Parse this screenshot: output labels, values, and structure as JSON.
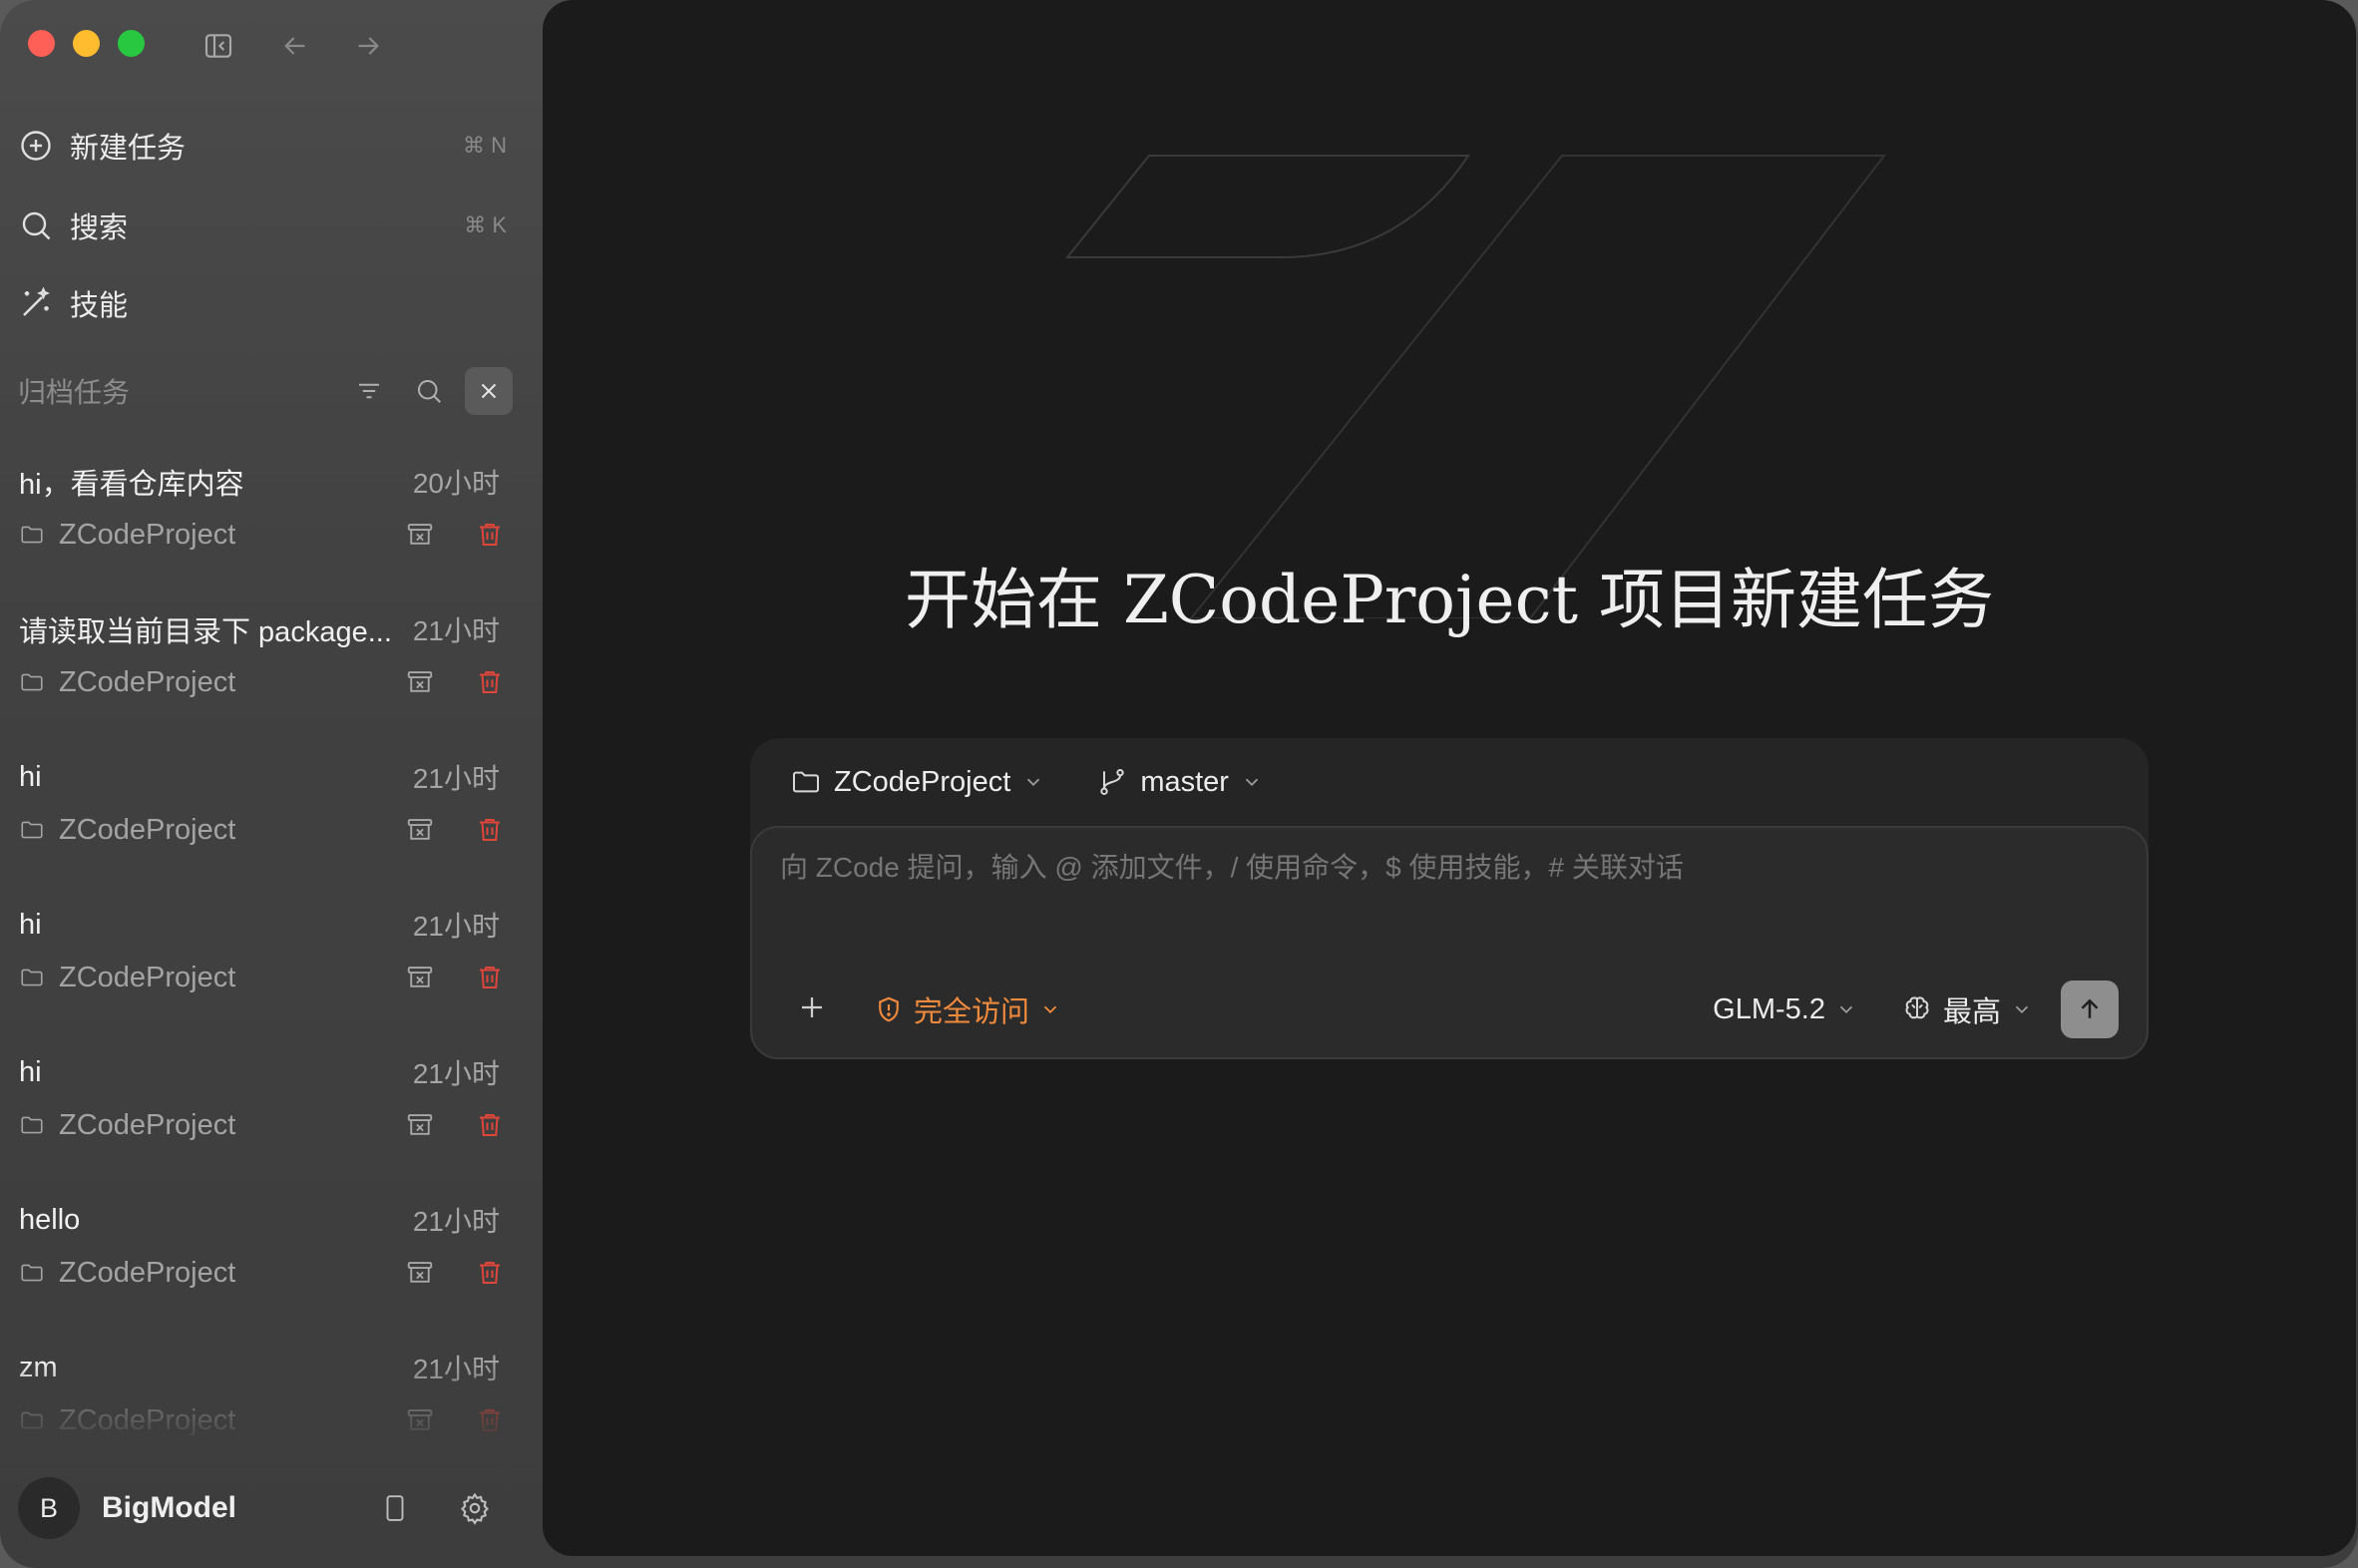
{
  "sidebar": {
    "nav": [
      {
        "label": "新建任务",
        "shortcut": "⌘ N",
        "icon": "plus-circle-icon"
      },
      {
        "label": "搜索",
        "shortcut": "⌘ K",
        "icon": "search-icon"
      },
      {
        "label": "技能",
        "shortcut": "",
        "icon": "magic-wand-icon"
      }
    ],
    "archive_title": "归档任务",
    "tasks": [
      {
        "title": "hi，看看仓库内容",
        "time": "20小时",
        "project": "ZCodeProject"
      },
      {
        "title": "请读取当前目录下 package...",
        "time": "21小时",
        "project": "ZCodeProject"
      },
      {
        "title": "hi",
        "time": "21小时",
        "project": "ZCodeProject"
      },
      {
        "title": "hi",
        "time": "21小时",
        "project": "ZCodeProject"
      },
      {
        "title": "hi",
        "time": "21小时",
        "project": "ZCodeProject"
      },
      {
        "title": "hello",
        "time": "21小时",
        "project": "ZCodeProject"
      },
      {
        "title": "zm",
        "time": "21小时",
        "project": "ZCodeProject"
      }
    ],
    "user": {
      "initial": "B",
      "name": "BigModel"
    }
  },
  "main": {
    "headline": "开始在 ZCodeProject 项目新建任务",
    "composer": {
      "project": "ZCodeProject",
      "branch": "master",
      "placeholder": "向 ZCode 提问，输入 @ 添加文件，/ 使用命令，$ 使用技能，# 关联对话",
      "access": "完全访问",
      "model": "GLM-5.2",
      "effort": "最高"
    }
  },
  "colors": {
    "accent_orange": "#f08a3c",
    "delete_red": "#e0453a",
    "main_bg": "#1b1b1b",
    "sidebar_bg": "#454545"
  }
}
